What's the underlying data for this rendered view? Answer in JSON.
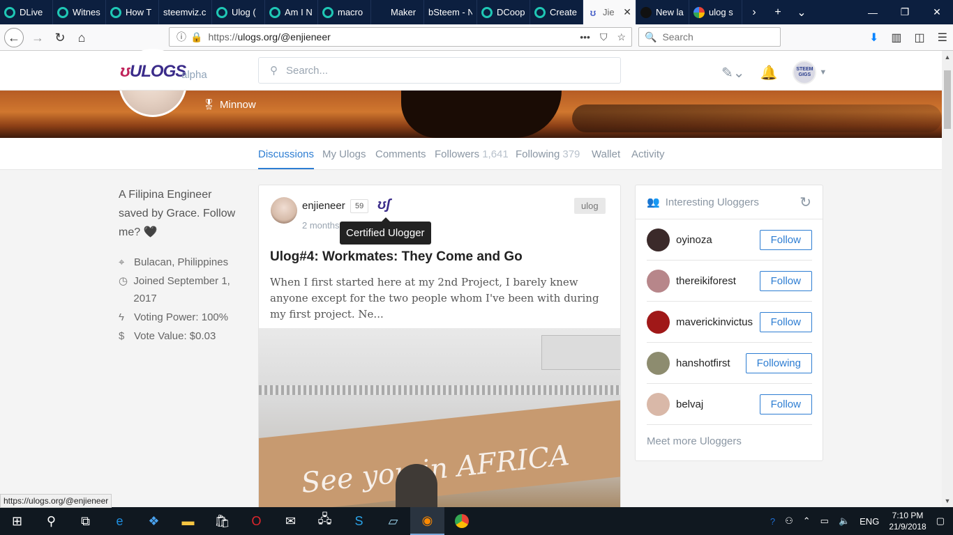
{
  "browser": {
    "tabs": [
      {
        "label": "DLive",
        "icon": "steem-icon"
      },
      {
        "label": "Witnes",
        "icon": "steem-icon"
      },
      {
        "label": "How T",
        "icon": "steem-icon"
      },
      {
        "label": "steemviz.c",
        "icon": "blank"
      },
      {
        "label": "Ulog (",
        "icon": "steem-icon"
      },
      {
        "label": "Am I N",
        "icon": "steem-icon"
      },
      {
        "label": "macro",
        "icon": "steem-icon"
      },
      {
        "label": "Maker",
        "icon": "blank"
      },
      {
        "label": "bSteem - N",
        "icon": "blank"
      },
      {
        "label": "DCoop",
        "icon": "steem-icon"
      },
      {
        "label": "Create",
        "icon": "steem-icon"
      },
      {
        "label": "Jie",
        "icon": "ulogs-icon"
      },
      {
        "label": "New la",
        "icon": "github-icon"
      },
      {
        "label": "ulog s",
        "icon": "google-icon"
      }
    ],
    "active_tab_index": 11,
    "url_protocol": "https://",
    "url_host": "ulogs.org",
    "url_path": "/@enjieneer",
    "search_placeholder": "Search",
    "status_link": "https://ulogs.org/@enjieneer"
  },
  "site": {
    "logo_text": "ULOGS",
    "logo_badge": "alpha",
    "search_placeholder": "Search...",
    "user_avatar_text_1": "STEEM",
    "user_avatar_text_2": "GIGS"
  },
  "profile": {
    "rank": "Minnow",
    "tabs": [
      {
        "label": "Discussions",
        "count": ""
      },
      {
        "label": "My Ulogs",
        "count": ""
      },
      {
        "label": "Comments",
        "count": ""
      },
      {
        "label": "Followers",
        "count": "1,641"
      },
      {
        "label": "Following",
        "count": "379"
      },
      {
        "label": "Wallet",
        "count": ""
      },
      {
        "label": "Activity",
        "count": ""
      }
    ],
    "bio": "A Filipina Engineer saved by Grace. Follow me? 🖤",
    "location": "Bulacan, Philippines",
    "joined": "Joined September 1, 2017",
    "voting_power": "Voting Power: 100%",
    "vote_value": "Vote Value: $0.03"
  },
  "post": {
    "author": "enjieneer",
    "reputation": "59",
    "time": "2 months",
    "tag": "ulog",
    "tooltip": "Certified Ulogger",
    "title": "Ulog#4: Workmates: They Come and Go",
    "excerpt": "When I first started here at my 2nd Project, I barely knew anyone except for the two people whom I've been with during my first project. Ne...",
    "image_text": "See you in AFRICA"
  },
  "widget": {
    "title": "Interesting Uloggers",
    "users": [
      {
        "name": "oyinoza",
        "button": "Follow",
        "color": "#3b2a2a"
      },
      {
        "name": "thereikiforest",
        "button": "Follow",
        "color": "#b7868a"
      },
      {
        "name": "maverickinvictus",
        "button": "Follow",
        "color": "#a01818"
      },
      {
        "name": "hanshotfirst",
        "button": "Following",
        "color": "#8d8c6f"
      },
      {
        "name": "belvaj",
        "button": "Follow",
        "color": "#d9b8a8"
      }
    ],
    "meet_more": "Meet more Uloggers"
  },
  "taskbar": {
    "language": "ENG",
    "time": "7:10 PM",
    "date": "21/9/2018"
  }
}
